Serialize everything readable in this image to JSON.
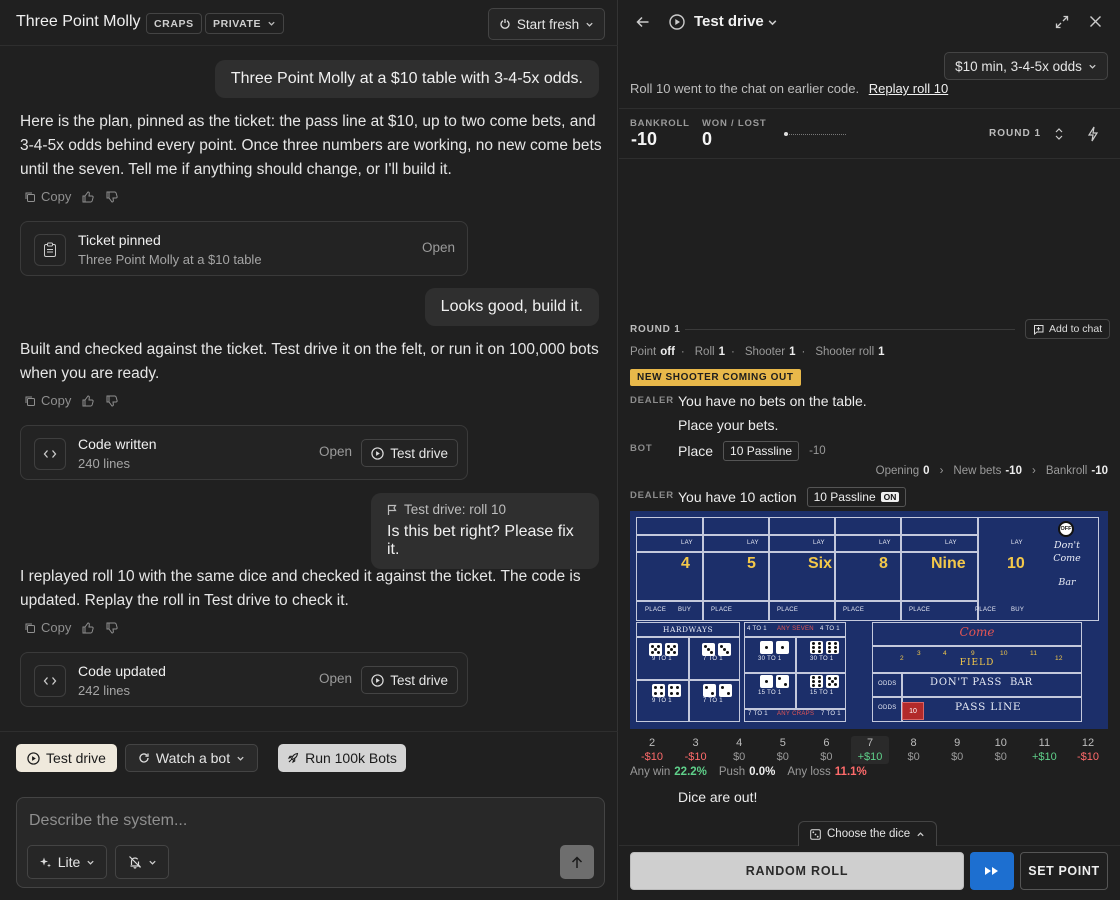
{
  "left": {
    "title": "Three Point Molly",
    "badge_craps": "CRAPS",
    "badge_private": "PRIVATE",
    "start_fresh": "Start fresh",
    "msg1": "Three Point Molly at a $10 table with 3-4-5x odds.",
    "reply1": "Here is the plan, pinned as the ticket: the pass line at $10, up to two come bets, and 3-4-5x odds behind every point. Once three numbers are working, no new come bets until the seven. Tell me if anything should change, or I'll build it.",
    "copy": "Copy",
    "card1": {
      "title": "Ticket pinned",
      "sub": "Three Point Molly at a $10 table",
      "open": "Open"
    },
    "msg2": "Looks good, build it.",
    "reply2": "Built and checked against the ticket. Test drive it on the felt, or run it on 100,000 bots when you are ready.",
    "card2": {
      "title": "Code written",
      "sub": "240 lines",
      "open": "Open",
      "btn": "Test drive"
    },
    "msg3_tag": "Test drive: roll 10",
    "msg3": "Is this bet right? Please fix it.",
    "reply3": "I replayed roll 10 with the same dice and checked it against the ticket. The code is updated. Replay the roll in Test drive to check it.",
    "card3": {
      "title": "Code updated",
      "sub": "242 lines",
      "open": "Open",
      "btn": "Test drive"
    },
    "tb_test": "Test drive",
    "tb_watch": "Watch a bot",
    "tb_run": "Run 100k Bots",
    "input_placeholder": "Describe the system...",
    "mode": "Lite"
  },
  "right": {
    "title": "Test drive",
    "table_select": "$10 min, 3-4-5x odds",
    "notice": "Roll 10 went to the chat on earlier code.",
    "replay": "Replay roll 10",
    "bankroll_label": "BANKROLL",
    "bankroll": "-10",
    "wonlost_label": "WON / LOST",
    "wonlost": "0",
    "round_label": "ROUND 1",
    "round_header": "ROUND 1",
    "add_to_chat": "Add to chat",
    "status": {
      "point_l": "Point",
      "point_v": "off",
      "roll_l": "Roll",
      "roll_v": "1",
      "shooter_l": "Shooter",
      "shooter_v": "1",
      "sroll_l": "Shooter roll",
      "sroll_v": "1"
    },
    "banner": "NEW SHOOTER COMING OUT",
    "dealer_tag": "DEALER",
    "bot_tag": "BOT",
    "dealer1": "You have no bets on the table.",
    "dealer1b": "Place your bets.",
    "bot_action": "Place",
    "bot_chip": "10 Passline",
    "bot_amt": "-10",
    "summary": {
      "opening_l": "Opening",
      "opening_v": "0",
      "new_l": "New bets",
      "new_v": "-10",
      "bank_l": "Bankroll",
      "bank_v": "-10"
    },
    "dealer2": "You have 10 action",
    "dealer2_chip": "10 Passline",
    "dealer2_on": "ON",
    "felt": {
      "numbers": [
        "4",
        "5",
        "Six",
        "8",
        "Nine",
        "10"
      ],
      "lay": "LAY",
      "place": "PLACE",
      "buy": "BUY",
      "off": "OFF",
      "dontcome": "Don't Come",
      "bar": "Bar",
      "hardways": "HARDWAYS",
      "nine_to_one": "9 TO 1",
      "seven_to_one": "7 TO 1",
      "four_to_one": "4 TO 1",
      "any_seven": "ANY SEVEN",
      "thirty_to_one": "30 TO 1",
      "fifteen_to_one": "15 TO 1",
      "any_craps": "ANY CRAPS",
      "come": "Come",
      "field": "FIELD",
      "field_nums": [
        "2",
        "3",
        "4",
        "9",
        "10",
        "11",
        "12"
      ],
      "odds": "ODDS",
      "dont_pass": "DON'T PASS",
      "bar2": "BAR",
      "pass_line": "PASS LINE",
      "pass_chip": "10"
    },
    "payouts": [
      {
        "n": "2",
        "v": "-$10"
      },
      {
        "n": "3",
        "v": "-$10"
      },
      {
        "n": "4",
        "v": "$0"
      },
      {
        "n": "5",
        "v": "$0"
      },
      {
        "n": "6",
        "v": "$0"
      },
      {
        "n": "7",
        "v": "+$10"
      },
      {
        "n": "8",
        "v": "$0"
      },
      {
        "n": "9",
        "v": "$0"
      },
      {
        "n": "10",
        "v": "$0"
      },
      {
        "n": "11",
        "v": "+$10"
      },
      {
        "n": "12",
        "v": "-$10"
      }
    ],
    "any_win_l": "Any win",
    "any_win": "22.2%",
    "push_l": "Push",
    "push": "0.0%",
    "any_loss_l": "Any loss",
    "any_loss": "11.1%",
    "dice_out": "Dice are out!",
    "choose_dice": "Choose the dice",
    "random_roll": "RANDOM ROLL",
    "set_point": "SET POINT"
  },
  "colors": {
    "accent_blue": "#1d6fd0",
    "win": "#5fd08a",
    "loss": "#ff6b6b",
    "banner": "#e8b84a",
    "felt": "#1c2f6a"
  }
}
